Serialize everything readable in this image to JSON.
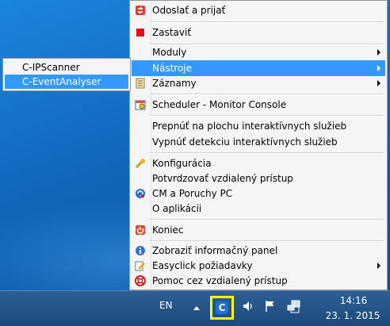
{
  "menu": {
    "items": [
      {
        "label": "Odoslať a prijať",
        "icon": "send-receive-icon"
      },
      {
        "label": "Zastaviť",
        "icon": "stop-icon"
      },
      {
        "label": "Moduly"
      },
      {
        "label": "Nástroje"
      },
      {
        "label": "Záznamy",
        "icon": "log-icon"
      },
      {
        "label": "Scheduler - Monitor Console",
        "icon": "calendar-icon"
      },
      {
        "label": "Prepnúť na plochu interaktívnych služieb"
      },
      {
        "label": "Vypnúť detekciu interaktívnych služieb"
      },
      {
        "label": "Konfigurácia",
        "icon": "wrench-icon"
      },
      {
        "label": "Potvrdzovať vzdialený prístup"
      },
      {
        "label": "CM a Poruchy PC",
        "icon": "cm-icon"
      },
      {
        "label": "O aplikácii"
      },
      {
        "label": "Koniec",
        "icon": "power-icon"
      },
      {
        "label": "Zobraziť informačný panel",
        "icon": "info-icon"
      },
      {
        "label": "Easyclick požiadavky",
        "icon": "edit-icon"
      },
      {
        "label": "Pomoc cez vzdialený prístup",
        "icon": "lifebuoy-icon"
      }
    ]
  },
  "submenu": {
    "items": [
      {
        "label": "C-IPScanner"
      },
      {
        "label": "C-EventAnalyser"
      }
    ]
  },
  "taskbar": {
    "language": "EN",
    "tray_app_letter": "C",
    "time": "14:16",
    "date": "23. 1. 2015"
  },
  "colors": {
    "highlight": "#3399ff",
    "tray_outline": "#ffff00",
    "taskbar": "#1e4a7b"
  }
}
